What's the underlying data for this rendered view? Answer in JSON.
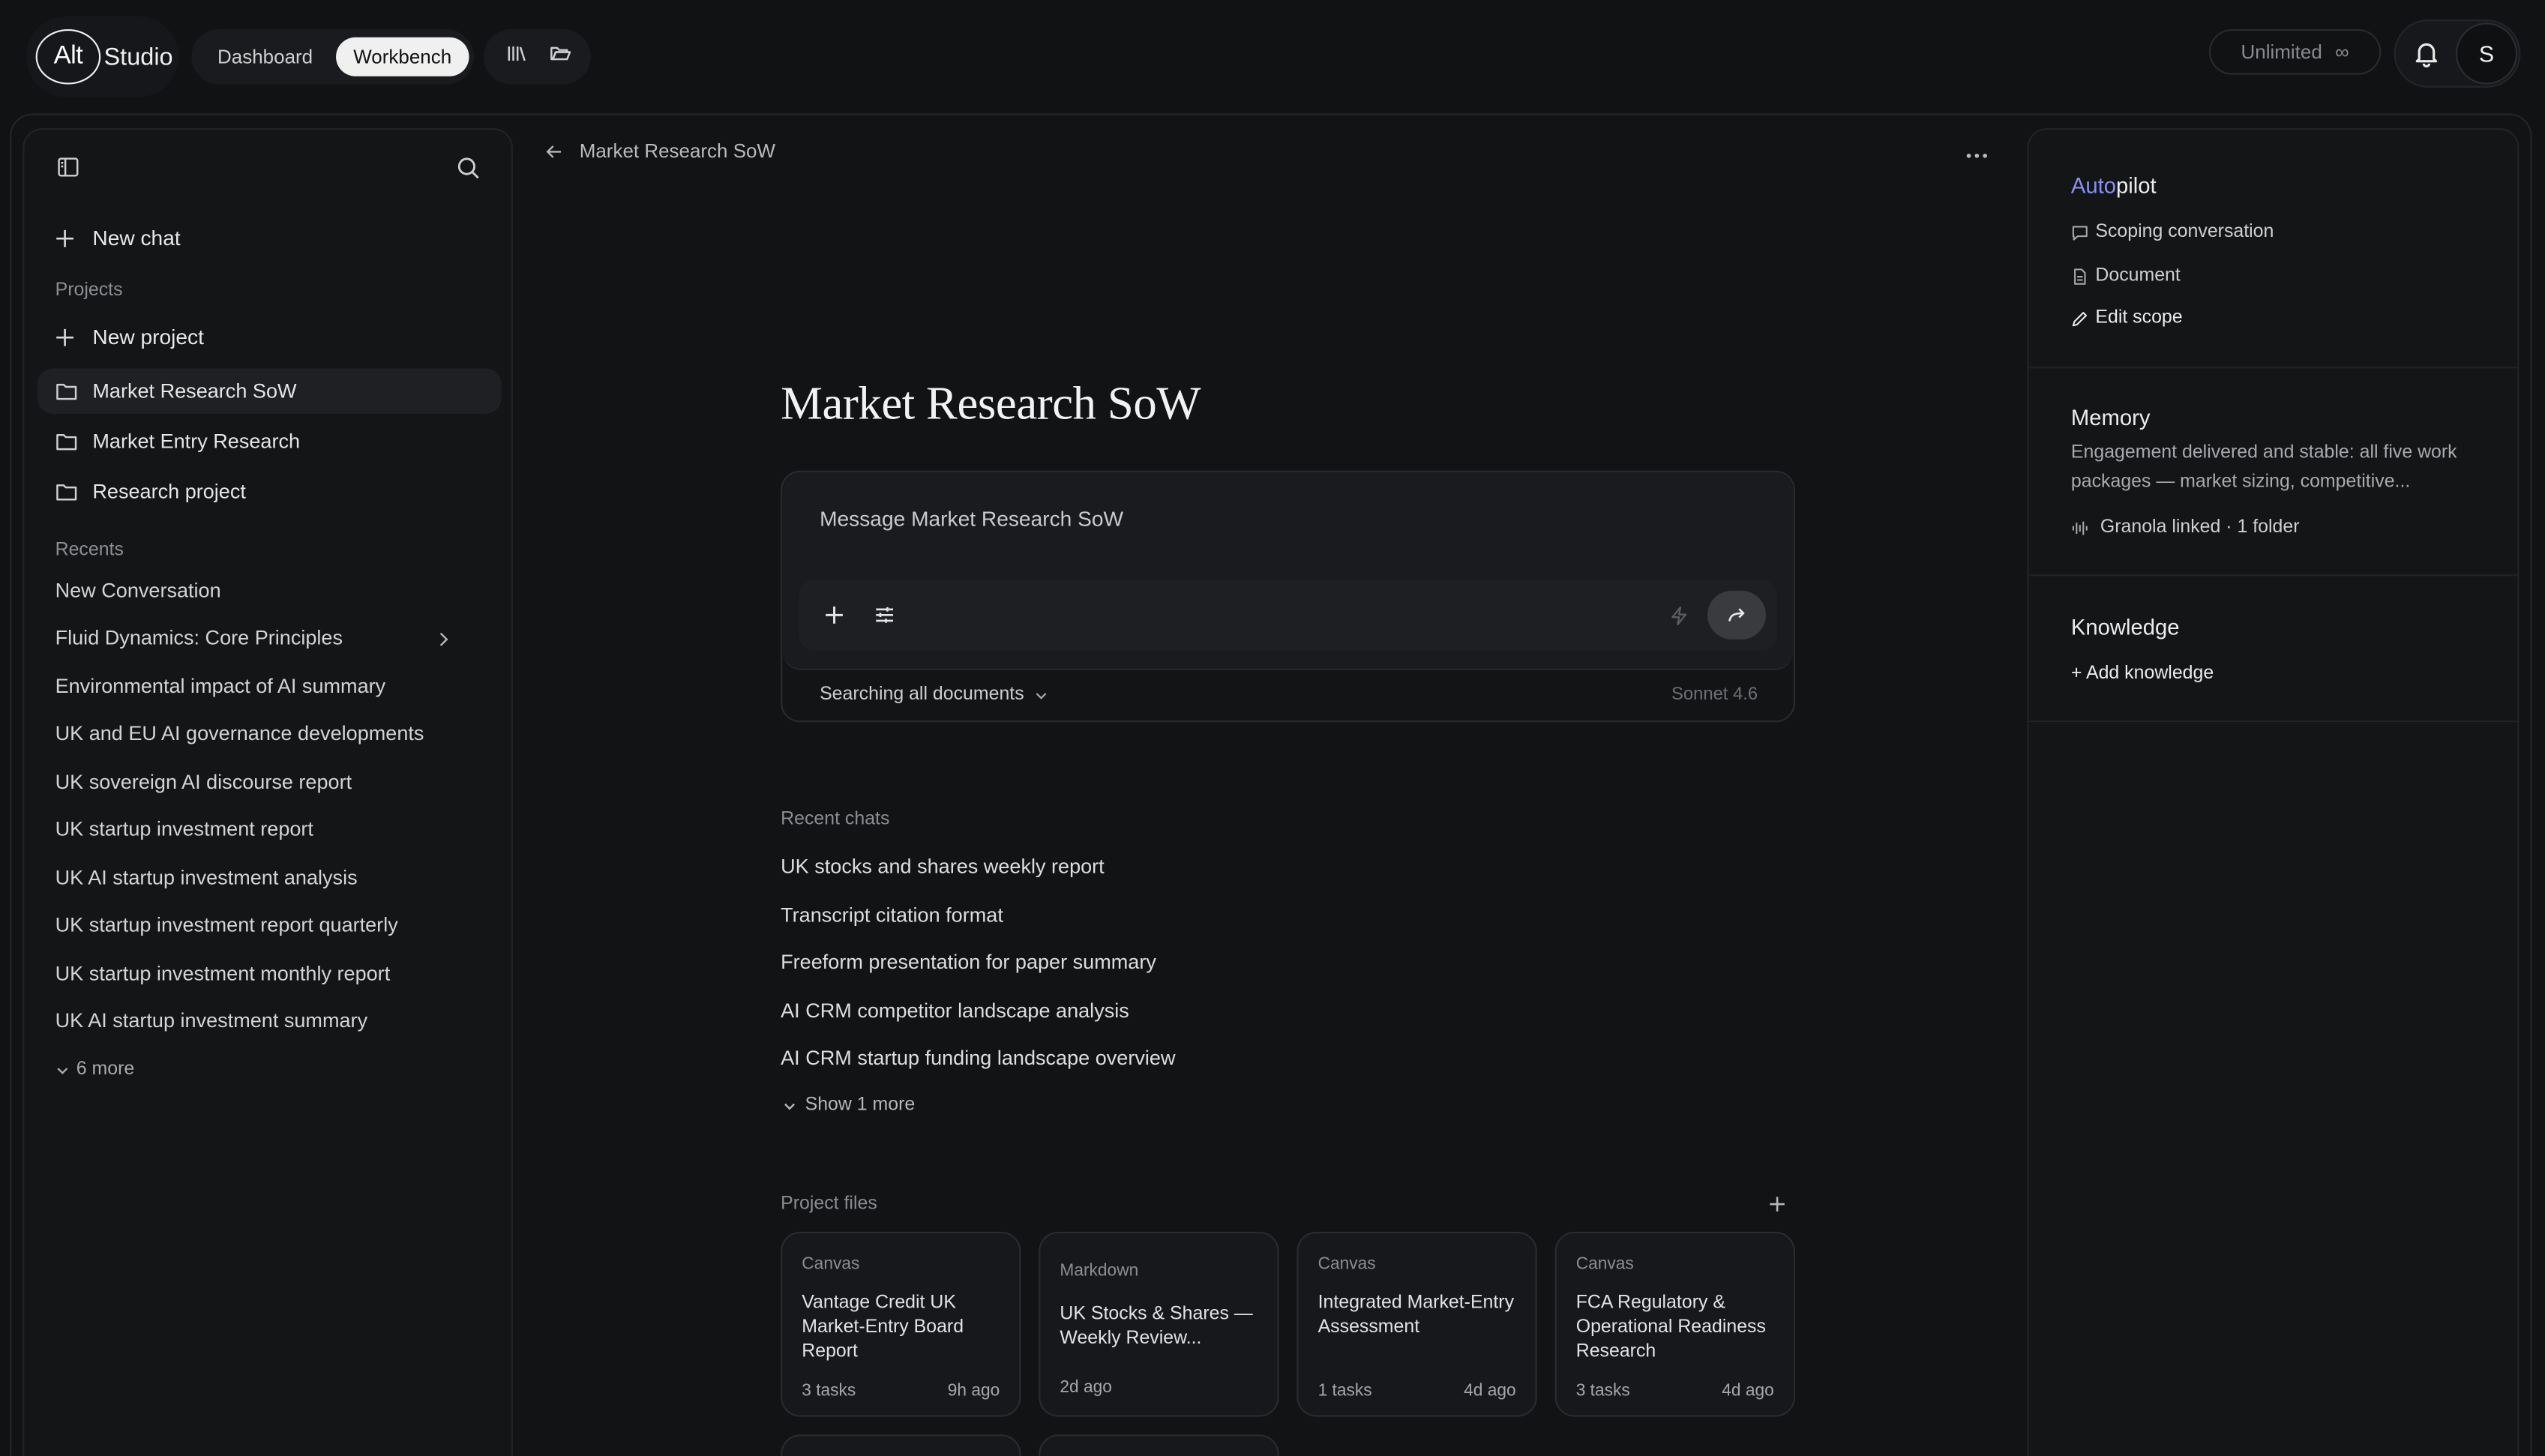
{
  "app": {
    "logo_alt": "Alt",
    "logo_studio": "Studio",
    "nav": [
      {
        "label": "Dashboard"
      },
      {
        "label": "Workbench"
      }
    ],
    "plan_label": "Unlimited",
    "plan_symbol": "∞",
    "avatar_initial": "S"
  },
  "sidebar": {
    "new_chat": "New chat",
    "projects_label": "Projects",
    "new_project": "New project",
    "projects": [
      {
        "name": "Market Research SoW"
      },
      {
        "name": "Market Entry Research"
      },
      {
        "name": "Research project"
      }
    ],
    "recents_label": "Recents",
    "recents": [
      "New Conversation",
      "Fluid Dynamics: Core Principles",
      "Environmental impact of AI summary",
      "UK and EU AI governance developments",
      "UK sovereign AI discourse report",
      "UK startup investment report",
      "UK AI startup investment analysis",
      "UK startup investment report quarterly",
      "UK startup investment monthly report",
      "UK AI startup investment summary"
    ],
    "more_label": "6 more"
  },
  "main": {
    "breadcrumb": "Market Research SoW",
    "title": "Market Research SoW",
    "composer": {
      "placeholder": "Message Market Research SoW",
      "search_scope": "Searching all documents",
      "model": "Sonnet 4.6"
    },
    "recent_chats_label": "Recent chats",
    "recent_chats": [
      "UK stocks and shares weekly report",
      "Transcript citation format",
      "Freeform presentation for paper summary",
      "AI CRM competitor landscape analysis",
      "AI CRM startup funding landscape overview"
    ],
    "show_more": "Show 1 more",
    "files_label": "Project files",
    "files": [
      {
        "type": "Canvas",
        "title": "Vantage Credit UK Market-Entry Board Report",
        "tasks": "3 tasks",
        "age": "9h ago"
      },
      {
        "type": "Markdown",
        "title": "UK Stocks & Shares — Weekly Review...",
        "tasks": "",
        "age": "2d ago"
      },
      {
        "type": "Canvas",
        "title": "Integrated Market-Entry Assessment",
        "tasks": "1 tasks",
        "age": "4d ago"
      },
      {
        "type": "Canvas",
        "title": "FCA Regulatory & Operational Readiness Research",
        "tasks": "3 tasks",
        "age": "4d ago"
      }
    ]
  },
  "panel": {
    "autopilot_a": "Auto",
    "autopilot_b": "pilot",
    "scoping": "Scoping conversation",
    "document": "Document",
    "edit_scope": "Edit scope",
    "memory_title": "Memory",
    "memory_text": "Engagement delivered and stable: all five work packages — market sizing, competitive...",
    "granola": "Granola linked · 1 folder",
    "knowledge_title": "Knowledge",
    "add_knowledge": "+ Add knowledge"
  },
  "colors": {
    "accent": "#8b8ff5",
    "background": "#111214"
  }
}
